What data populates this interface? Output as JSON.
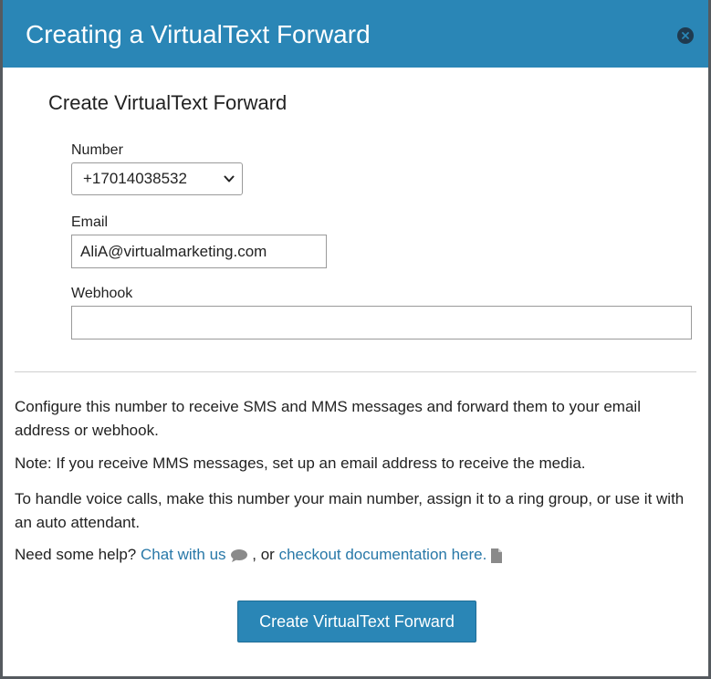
{
  "header": {
    "title": "Creating a VirtualText Forward",
    "close_icon": "close-circle-icon"
  },
  "form": {
    "section_title": "Create VirtualText Forward",
    "number_label": "Number",
    "number_value": "+17014038532",
    "email_label": "Email",
    "email_value": "AliA@virtualmarketing.com",
    "webhook_label": "Webhook",
    "webhook_value": ""
  },
  "info": {
    "p1": "Configure this number to receive SMS and MMS messages and forward them to your email address or webhook.",
    "p2": "Note: If you receive MMS messages, set up an email address to receive the media.",
    "p3": "To handle voice calls, make this number your main number, assign it to a ring group, or use it with an auto attendant.",
    "help_prefix": "Need some help?",
    "chat_link": "Chat with us",
    "chat_icon": "chat-bubble-icon",
    "separator": ", or",
    "docs_link": "checkout documentation here.",
    "docs_icon": "document-icon"
  },
  "actions": {
    "submit_label": "Create VirtualText Forward"
  },
  "colors": {
    "header_bg": "#2a86b6",
    "link": "#2878a8",
    "button_bg": "#2a86b6"
  }
}
